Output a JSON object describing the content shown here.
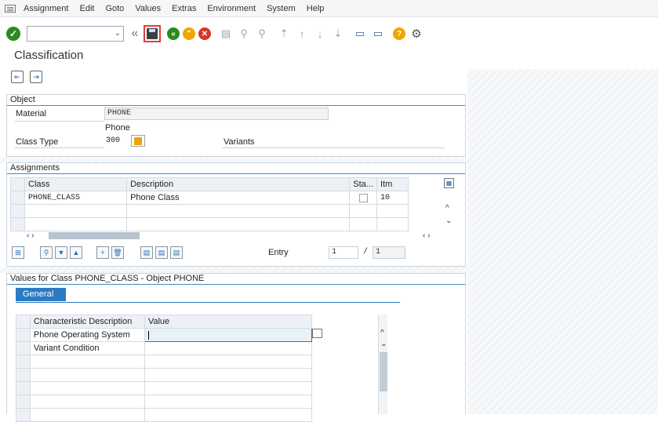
{
  "menu": [
    "Assignment",
    "Edit",
    "Goto",
    "Values",
    "Extras",
    "Environment",
    "System",
    "Help"
  ],
  "toolbar": {
    "command_placeholder": ""
  },
  "page_title": "Classification",
  "object_group": {
    "title": "Object",
    "material_label": "Material",
    "material_value": "PHONE",
    "material_desc": "Phone",
    "class_type_label": "Class Type",
    "class_type_value": "300",
    "variants_label": "Variants"
  },
  "assignments": {
    "title": "Assignments",
    "columns": [
      "Class",
      "Description",
      "Sta...",
      "Itm"
    ],
    "rows": [
      {
        "class": "PHONE_CLASS",
        "description": "Phone Class",
        "item": "10"
      }
    ],
    "entry_label": "Entry",
    "entry_value": "1",
    "entry_total": "/ 1",
    "total_value": "1"
  },
  "values_section": {
    "title": "Values for Class PHONE_CLASS - Object PHONE",
    "tab_general": "General",
    "columns": [
      "Characteristic Description",
      "Value"
    ],
    "rows": [
      "Phone Operating System",
      "Variant Condition"
    ]
  }
}
